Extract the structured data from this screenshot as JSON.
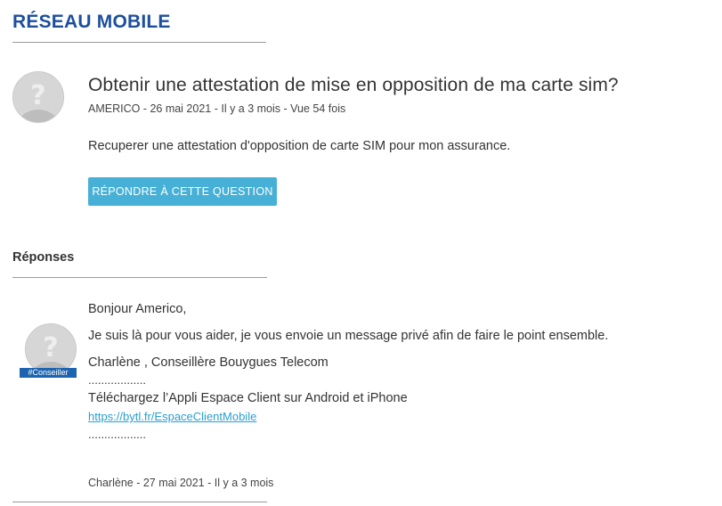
{
  "section": {
    "title": "RÉSEAU MOBILE"
  },
  "question": {
    "title": "Obtenir une attestation de mise en opposition de ma carte sim?",
    "meta": "AMERICO - 26 mai 2021 - Il y a 3 mois - Vue 54 fois",
    "body": "Recuperer une attestation d'opposition de carte SIM pour mon assurance.",
    "reply_button": "RÉPONDRE À CETTE QUESTION",
    "avatar_icon": "default-user-avatar-icon"
  },
  "answers": {
    "heading": "Réponses",
    "items": [
      {
        "badge": "#Conseiller",
        "avatar_icon": "default-user-avatar-icon",
        "lines": [
          "Bonjour Americo,",
          "Je suis là pour vous aider, je vous envoie un message privé afin de faire le point ensemble.",
          "Charlène , Conseillère Bouygues Telecom",
          "..................",
          "Téléchargez l’Appli Espace Client sur Android et iPhone"
        ],
        "link": "https://bytl.fr/EspaceClientMobile",
        "trailing_dots": "..................",
        "meta": "Charlène - 27 mai 2021 - Il y a 3 mois"
      }
    ]
  },
  "colors": {
    "brand_blue": "#1d4f9c",
    "button_blue": "#47b0d6",
    "link_blue": "#2a9fd0",
    "badge_blue": "#1d64b0"
  }
}
